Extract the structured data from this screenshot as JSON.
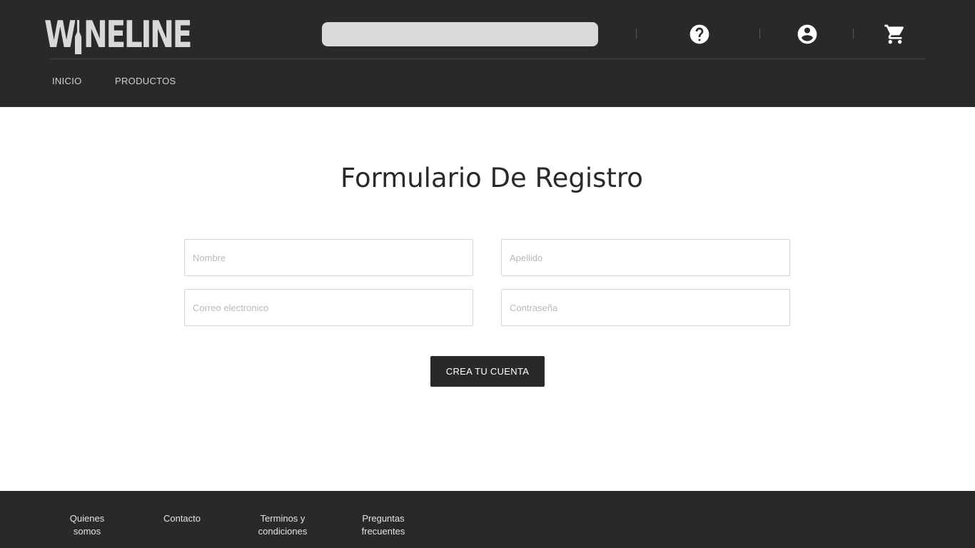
{
  "header": {
    "logo_text": "WINELINE",
    "search": {
      "placeholder": "",
      "value": ""
    },
    "icons": {
      "help": "help-circle-icon",
      "account": "account-circle-icon",
      "cart": "shopping-cart-icon"
    }
  },
  "nav": {
    "items": [
      {
        "label": "INICIO"
      },
      {
        "label": "PRODUCTOS"
      }
    ]
  },
  "main": {
    "title": "Formulario De Registro",
    "fields": {
      "nombre": {
        "placeholder": "Nombre",
        "value": ""
      },
      "apellido": {
        "placeholder": "Apellido",
        "value": ""
      },
      "correo": {
        "placeholder": "Correo electronico",
        "value": ""
      },
      "contrasena": {
        "placeholder": "Contraseña",
        "value": ""
      }
    },
    "submit_label": "CREA TU CUENTA"
  },
  "footer": {
    "links": [
      {
        "label": "Quienes\nsomos"
      },
      {
        "label": "Contacto"
      },
      {
        "label": "Terminos y\ncondiciones"
      },
      {
        "label": "Preguntas\nfrecuentes"
      }
    ]
  },
  "colors": {
    "header_bg": "#292929",
    "logo": "#d8d8d8",
    "search_bg": "#d9d9d9",
    "button_bg": "#292929",
    "page_bg": "#ffffff"
  }
}
